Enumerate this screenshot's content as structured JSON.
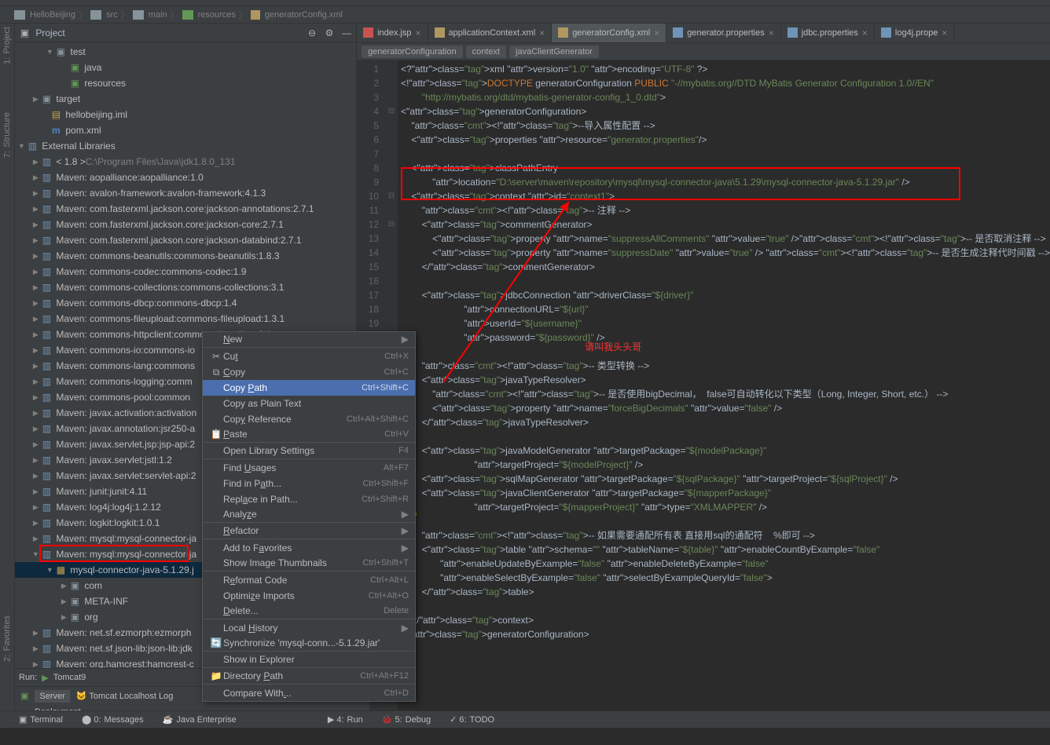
{
  "breadcrumb": {
    "root": "HelloBeijing",
    "parts": [
      "src",
      "main",
      "resources",
      "generatorConfig.xml"
    ]
  },
  "projectLabel": "Project",
  "tree": {
    "test": "test",
    "java": "java",
    "resources": "resources",
    "target": "target",
    "hb_iml": "hellobeijing.iml",
    "pom": "pom.xml",
    "extlib": "External Libraries",
    "jdk": "< 1.8 >",
    "jdk_path": "C:\\Program Files\\Java\\jdk1.8.0_131",
    "libs": [
      "Maven: aopalliance:aopalliance:1.0",
      "Maven: avalon-framework:avalon-framework:4.1.3",
      "Maven: com.fasterxml.jackson.core:jackson-annotations:2.7.1",
      "Maven: com.fasterxml.jackson.core:jackson-core:2.7.1",
      "Maven: com.fasterxml.jackson.core:jackson-databind:2.7.1",
      "Maven: commons-beanutils:commons-beanutils:1.8.3",
      "Maven: commons-codec:commons-codec:1.9",
      "Maven: commons-collections:commons-collections:3.1",
      "Maven: commons-dbcp:commons-dbcp:1.4",
      "Maven: commons-fileupload:commons-fileupload:1.3.1",
      "Maven: commons-httpclient:commons-httpclient:3.1",
      "Maven: commons-io:commons-io",
      "Maven: commons-lang:commons",
      "Maven: commons-logging:comm",
      "Maven: commons-pool:common",
      "Maven: javax.activation:activation",
      "Maven: javax.annotation:jsr250-a",
      "Maven: javax.servlet.jsp:jsp-api:2",
      "Maven: javax.servlet:jstl:1.2",
      "Maven: javax.servlet:servlet-api:2",
      "Maven: junit:junit:4.11",
      "Maven: log4j:log4j:1.2.12",
      "Maven: logkit:logkit:1.0.1",
      "Maven: mysql:mysql-connector-ja"
    ],
    "jar": "mysql-connector-java-5.1.29.j",
    "jar_children": [
      "com",
      "META-INF",
      "org"
    ],
    "libs_after": [
      "Maven: net.sf.ezmorph:ezmorph",
      "Maven: net.sf.json-lib:json-lib:jdk",
      "Maven: org.hamcrest:hamcrest-c"
    ]
  },
  "tabs": [
    {
      "label": "index.jsp",
      "cls": "jsp"
    },
    {
      "label": "applicationContext.xml",
      "cls": "xml"
    },
    {
      "label": "generatorConfig.xml",
      "cls": "xml",
      "active": true
    },
    {
      "label": "generator.properties",
      "cls": "prop"
    },
    {
      "label": "jdbc.properties",
      "cls": "prop"
    },
    {
      "label": "log4j.prope",
      "cls": "prop"
    }
  ],
  "crumbs": [
    "generatorConfiguration",
    "context",
    "javaClientGenerator"
  ],
  "menu": {
    "new": "New",
    "cut": "Cut",
    "copy": "Copy",
    "copyPath": "Copy Path",
    "copyPlain": "Copy as Plain Text",
    "copyRef": "Copy Reference",
    "paste": "Paste",
    "openLib": "Open Library Settings",
    "findUsages": "Find Usages",
    "findInPath": "Find in Path...",
    "replaceInPath": "Replace in Path...",
    "analyze": "Analyze",
    "refactor": "Refactor",
    "addFav": "Add to Favorites",
    "showThumb": "Show Image Thumbnails",
    "reformat": "Reformat Code",
    "optimize": "Optimize Imports",
    "delete": "Delete...",
    "localHist": "Local History",
    "sync": "Synchronize 'mysql-conn...-5.1.29.jar'",
    "showExp": "Show in Explorer",
    "dirPath": "Directory Path",
    "compare": "Compare With...",
    "sc": {
      "cut": "Ctrl+X",
      "copy": "Ctrl+C",
      "copyPath": "Ctrl+Shift+C",
      "copyRef": "Ctrl+Alt+Shift+C",
      "paste": "Ctrl+V",
      "openLib": "F4",
      "findUsages": "Alt+F7",
      "findInPath": "Ctrl+Shift+F",
      "replaceInPath": "Ctrl+Shift+R",
      "showThumb": "Ctrl+Shift+T",
      "reformat": "Ctrl+Alt+L",
      "optimize": "Ctrl+Alt+O",
      "delete": "Delete",
      "dirPath": "Ctrl+Alt+F12",
      "compare": "Ctrl+D"
    }
  },
  "run": {
    "title": "Run:",
    "config": "Tomcat9",
    "server": "Server",
    "log": "Tomcat Localhost Log",
    "deploy": "Deployment"
  },
  "btm": [
    "Terminal",
    "Messages",
    "Java Enterprise",
    "Run",
    "Debug",
    "TODO"
  ],
  "annot": "请叫我头头哥",
  "code_lines": [
    "<?xml version=\"1.0\" encoding=\"UTF-8\" ?>",
    "<!DOCTYPE generatorConfiguration PUBLIC \"-//mybatis.org//DTD MyBatis Generator Configuration 1.0//EN\"",
    "        \"http://mybatis.org/dtd/mybatis-generator-config_1_0.dtd\">",
    "<generatorConfiguration>",
    "    <!--导入属性配置 -->",
    "    <properties resource=\"generator.properties\"/>",
    "",
    "    <classPathEntry",
    "            location=\"D:\\server\\maven\\repository\\mysql\\mysql-connector-java\\5.1.29\\mysql-connector-java-5.1.29.jar\" />",
    "    <context id=\"context1\">",
    "        <!-- 注释 -->",
    "        <commentGenerator>",
    "            <property name=\"suppressAllComments\" value=\"true\" /><!-- 是否取消注释 -->",
    "            <property name=\"suppressDate\" value=\"true\" /> <!-- 是否生成注释代时间戳 -->",
    "        </commentGenerator>",
    "",
    "        <jdbcConnection driverClass=\"${driver}\"",
    "                        connectionURL=\"${url}\"",
    "                        userId=\"${username}\"",
    "                        password=\"${password}\" />",
    "",
    "        <!-- 类型转换 -->",
    "        <javaTypeResolver>",
    "            <!-- 是否使用bigDecimal，  false可自动转化以下类型（Long, Integer, Short, etc.） -->",
    "            <property name=\"forceBigDecimals\" value=\"false\" />",
    "        </javaTypeResolver>",
    "",
    "        <javaModelGenerator targetPackage=\"${modelPackage}\"",
    "                            targetProject=\"${modelProject}\" />",
    "        <sqlMapGenerator targetPackage=\"${sqlPackage}\" targetProject=\"${sqlProject}\" />",
    "        <javaClientGenerator targetPackage=\"${mapperPackage}\"",
    "                            targetProject=\"${mapperProject}\" type=\"XMLMAPPER\" />",
    "",
    "        <!-- 如果需要通配所有表 直接用sql的通配符    %即可 -->",
    "        <table schema=\"\" tableName=\"${table}\" enableCountByExample=\"false\"",
    "               enableUpdateByExample=\"false\" enableDeleteByExample=\"false\"",
    "               enableSelectByExample=\"false\" selectByExampleQueryId=\"false\">",
    "        </table>",
    "",
    "    </context>",
    "</generatorConfiguration>"
  ]
}
